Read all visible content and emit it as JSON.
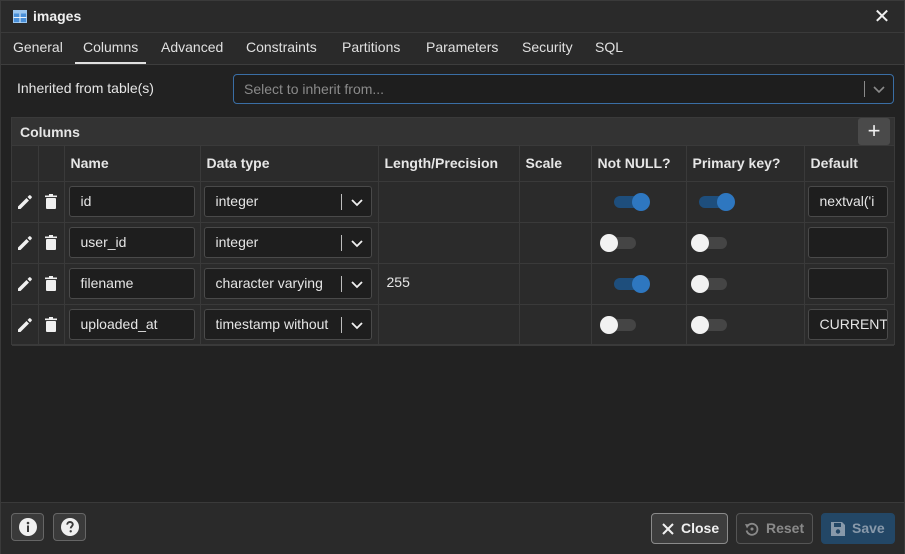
{
  "dialog": {
    "title": "images",
    "tabs": [
      {
        "label": "General",
        "active": false
      },
      {
        "label": "Columns",
        "active": true
      },
      {
        "label": "Advanced",
        "active": false
      },
      {
        "label": "Constraints",
        "active": false
      },
      {
        "label": "Partitions",
        "active": false
      },
      {
        "label": "Parameters",
        "active": false
      },
      {
        "label": "Security",
        "active": false
      },
      {
        "label": "SQL",
        "active": false
      }
    ]
  },
  "inherit": {
    "label": "Inherited from table(s)",
    "placeholder": "Select to inherit from..."
  },
  "columns_panel": {
    "title": "Columns",
    "headers": {
      "name": "Name",
      "data_type": "Data type",
      "length": "Length/Precision",
      "scale": "Scale",
      "not_null": "Not NULL?",
      "primary_key": "Primary key?",
      "default": "Default"
    },
    "rows": [
      {
        "name": "id",
        "data_type": "integer",
        "length": "",
        "scale": "",
        "not_null": true,
        "primary_key": true,
        "default": "nextval('i"
      },
      {
        "name": "user_id",
        "data_type": "integer",
        "length": "",
        "scale": "",
        "not_null": false,
        "primary_key": false,
        "default": ""
      },
      {
        "name": "filename",
        "data_type": "character varying",
        "length": "255",
        "scale": "",
        "not_null": true,
        "primary_key": false,
        "default": ""
      },
      {
        "name": "uploaded_at",
        "data_type": "timestamp without",
        "length": "",
        "scale": "",
        "not_null": false,
        "primary_key": false,
        "default": "CURRENT"
      }
    ]
  },
  "footer": {
    "close_label": "Close",
    "reset_label": "Reset",
    "save_label": "Save"
  },
  "colors": {
    "accent": "#2e77c0",
    "toggle_on_track": "#1e4e7c",
    "background": "#222222",
    "save_button": "#234766"
  },
  "icons": [
    "table-icon",
    "close-icon",
    "chevron-down-icon",
    "add-icon",
    "edit-icon",
    "trash-icon",
    "info-icon",
    "help-icon",
    "reset-icon",
    "save-icon"
  ]
}
